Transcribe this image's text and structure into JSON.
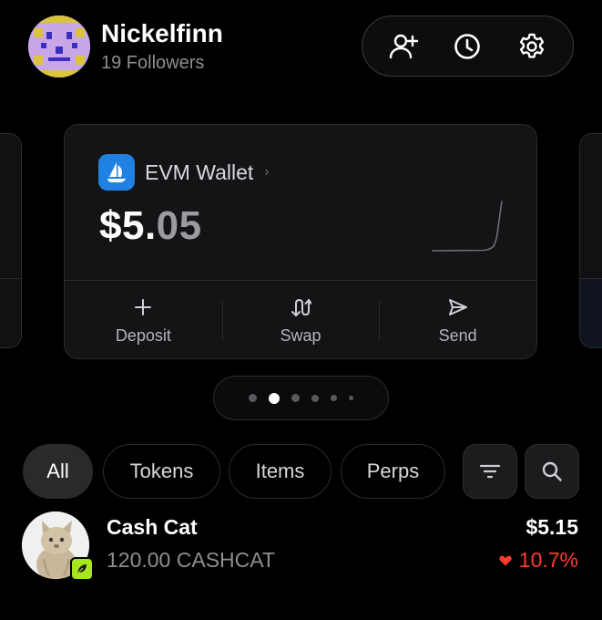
{
  "profile": {
    "name": "Nickelfinn",
    "followers": "19 Followers"
  },
  "header_actions": [
    {
      "icon": "add-friend-icon"
    },
    {
      "icon": "history-clock-icon"
    },
    {
      "icon": "settings-gear-icon"
    }
  ],
  "wallet": {
    "name": "EVM Wallet",
    "logo_icon": "opensea-icon",
    "balance_main": "$5.",
    "balance_cents": "05",
    "actions": [
      {
        "label": "Deposit",
        "icon": "plus-icon"
      },
      {
        "label": "Swap",
        "icon": "swap-icon"
      },
      {
        "label": "Send",
        "icon": "send-icon"
      }
    ]
  },
  "pager": {
    "pages": 6,
    "active_index": 1
  },
  "filters": {
    "chips": [
      "All",
      "Tokens",
      "Items",
      "Perps"
    ],
    "active": "All",
    "filter_icon": "filter-icon",
    "search_icon": "search-icon"
  },
  "tokens": [
    {
      "name": "Cash Cat",
      "amount": "120.00 CASHCAT",
      "value": "$5.15",
      "change": "10.7%",
      "change_direction": "down"
    }
  ],
  "colors": {
    "negative": "#ff3b30",
    "wallet_logo": "#2081e2",
    "badge": "#a8e61d"
  }
}
